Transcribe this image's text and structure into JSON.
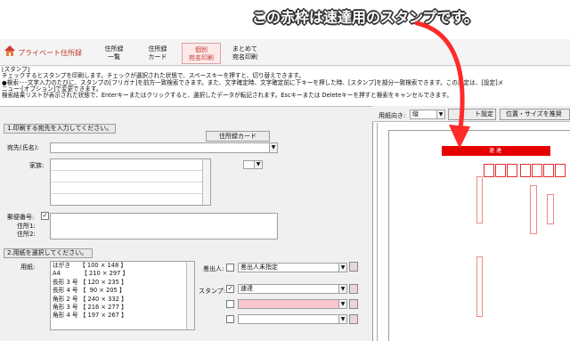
{
  "callout": {
    "text": "この赤枠は速達用のスタンプです。",
    "color": "#ff2a2a"
  },
  "app": {
    "title": "プライベート住所録"
  },
  "toolbar": [
    {
      "label": "住所録\n一覧"
    },
    {
      "label": "住所録\nカード"
    },
    {
      "label": "個別\n宛名印刷",
      "active": true
    },
    {
      "label": "まとめて\n宛名印刷"
    }
  ],
  "help": {
    "lines": [
      "[スタンプ]",
      "チェックするとスタンプを印刷します。チェックが選択された状態で、スペースキーを押すと、切り替えできます。",
      "●検索･･･文字入力のたびに、スタンプの[フリガナ]を前方一致検索できます。また、文字確定時、文字確定前に下キーを押した時、[スタンプ]を部分一致検索できます。この設定は、[設定]メ",
      "ニュー-[オプション]で変更できます。",
      "検索結果リストが表示された状態で、Enterキーまたはクリックすると、選択したデータが転記されます。Escキーまたは Deleteキーを押すと検索をキャンセルできます。"
    ]
  },
  "section1": {
    "header": "1.印刷する宛先を入力してください。",
    "card_button": "住所録カード",
    "name_label": "宛先(氏名):",
    "family_label": "家族:",
    "postal_label": "郵便番号:",
    "address1_label": "住所1:",
    "address2_label": "住所2:"
  },
  "section2": {
    "header": "2.用紙を選択してください。",
    "paper_label": "用紙:",
    "paper_items": [
      "はがき　　【 100 × 148 】",
      "A4　　　　【 210 × 297 】",
      "長形 3 号 【 120 × 235 】",
      "長形 4 号 【  90 × 205 】",
      "角形 2 号 【 240 × 332 】",
      "角形 3 号 【 216 × 277 】",
      "角形 4 号 【 197 × 267 】"
    ],
    "sender_label": "差出人:",
    "sender_value": "差出人未指定",
    "stamp_label": "スタンプ:",
    "stamp_value": "速達",
    "stamp_checked": true,
    "sender_checked": false
  },
  "preview": {
    "orientation_label": "用紙向き:",
    "orientation_value": "縦",
    "print_settings_btn": "ト設定",
    "position_btn": "位置・サイズを推奨",
    "stamp_text": "速達",
    "stamp_color": "#e60000"
  }
}
